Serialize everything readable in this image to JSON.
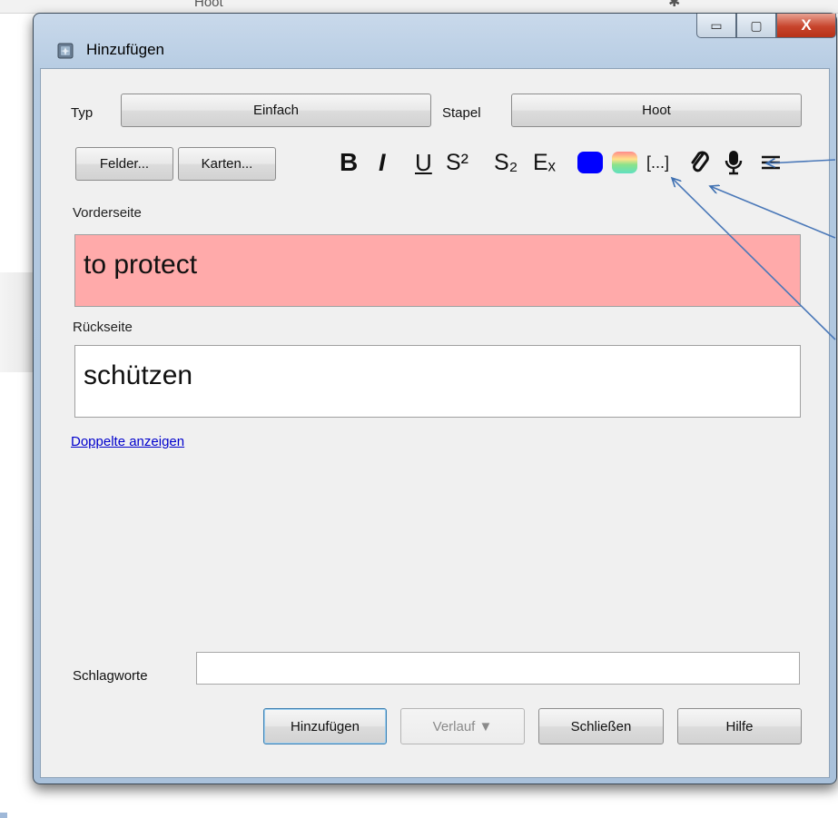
{
  "background": {
    "title": "Hoot"
  },
  "window": {
    "title": "Hinzufügen",
    "controls": {
      "minimize": "▭",
      "maximize": "▢",
      "close": "X"
    }
  },
  "top_row": {
    "type_label": "Typ",
    "type_value": "Einfach",
    "deck_label": "Stapel",
    "deck_value": "Hoot"
  },
  "buttons": {
    "fields": "Felder...",
    "cards": "Karten..."
  },
  "format_toolbar": {
    "bold": "B",
    "italic": "I",
    "underline": "U",
    "superscript": "S²",
    "subscript": "S₂",
    "clear_format": "Eₓ",
    "cloze": "[...]",
    "colors": {
      "text_color": "#0000ff",
      "highlight_top": "#ff8a8a",
      "highlight_bottom": "#60e0b0"
    }
  },
  "fields": [
    {
      "name": "Vorderseite",
      "value": "to protect",
      "bg": "#ffaaaa"
    },
    {
      "name": "Rückseite",
      "value": "schützen",
      "bg": "#ffffff"
    }
  ],
  "duplicates_link": "Doppelte anzeigen",
  "tags": {
    "label": "Schlagworte",
    "value": ""
  },
  "bottom_buttons": {
    "add": "Hinzufügen",
    "history": "Verlauf ▼",
    "close": "Schließen",
    "help": "Hilfe"
  }
}
